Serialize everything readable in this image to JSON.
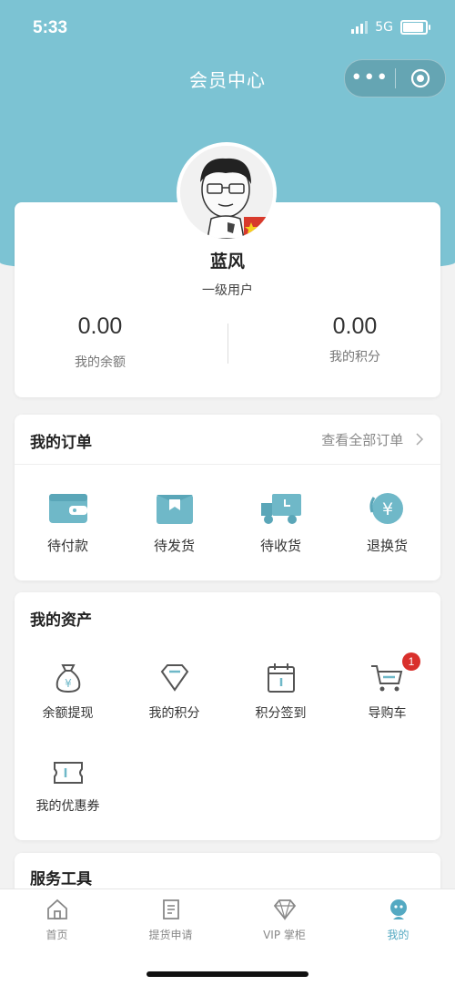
{
  "status_bar": {
    "time": "5:33",
    "network": "5G"
  },
  "header": {
    "title": "会员中心",
    "capsule_more": "•••"
  },
  "profile": {
    "name": "蓝风",
    "level": "一级用户",
    "balance_value": "0.00",
    "balance_label": "我的余额",
    "points_value": "0.00",
    "points_label": "我的积分"
  },
  "orders": {
    "title": "我的订单",
    "view_all": "查看全部订单",
    "items": [
      {
        "label": "待付款",
        "icon": "wallet-icon"
      },
      {
        "label": "待发货",
        "icon": "box-icon"
      },
      {
        "label": "待收货",
        "icon": "truck-icon"
      },
      {
        "label": "退换货",
        "icon": "yen-refund-icon"
      }
    ]
  },
  "assets": {
    "title": "我的资产",
    "items": [
      {
        "label": "余额提现",
        "icon": "money-bag-icon"
      },
      {
        "label": "我的积分",
        "icon": "diamond-icon"
      },
      {
        "label": "积分签到",
        "icon": "calendar-icon"
      },
      {
        "label": "导购车",
        "icon": "cart-icon",
        "badge": "1"
      },
      {
        "label": "我的优惠券",
        "icon": "coupon-icon"
      }
    ]
  },
  "services": {
    "title": "服务工具"
  },
  "tabbar": {
    "items": [
      {
        "label": "首页",
        "icon": "home-icon"
      },
      {
        "label": "提货申请",
        "icon": "receipt-icon"
      },
      {
        "label": "VIP 掌柜",
        "icon": "gem-icon"
      },
      {
        "label": "我的",
        "icon": "profile-icon",
        "active": true
      }
    ]
  },
  "colors": {
    "header": "#7cc3d3",
    "accent": "#54a9c2",
    "icon_teal": "#6fb8c8",
    "badge": "#d9302c"
  }
}
